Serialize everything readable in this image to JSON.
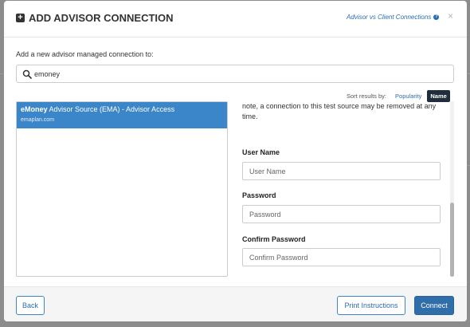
{
  "modal": {
    "title": "ADD ADVISOR CONNECTION",
    "help_link": "Advisor vs Client Connections",
    "close_glyph": "×"
  },
  "intro": "Add a new advisor managed connection to:",
  "search": {
    "value": "emoney",
    "placeholder": "",
    "icon": "search-icon"
  },
  "sort": {
    "label": "Sort results by:",
    "options": [
      "Popularity",
      "Name"
    ],
    "selected": "Name"
  },
  "results": [
    {
      "name_bold": "eMoney",
      "name_rest": " Advisor Source (EMA) - Advisor Access",
      "domain": "emaplan.com",
      "selected": true
    }
  ],
  "details": {
    "note": "note, a connection to this test source may be removed at any time.",
    "fields": [
      {
        "label": "User Name",
        "placeholder": "User Name"
      },
      {
        "label": "Password",
        "placeholder": "Password"
      },
      {
        "label": "Confirm Password",
        "placeholder": "Confirm Password"
      }
    ]
  },
  "footer": {
    "back": "Back",
    "print": "Print Instructions",
    "connect": "Connect"
  },
  "colors": {
    "accent": "#3a86c8",
    "primary_button": "#2f6ea9",
    "sort_active": "#1f2d3d"
  }
}
